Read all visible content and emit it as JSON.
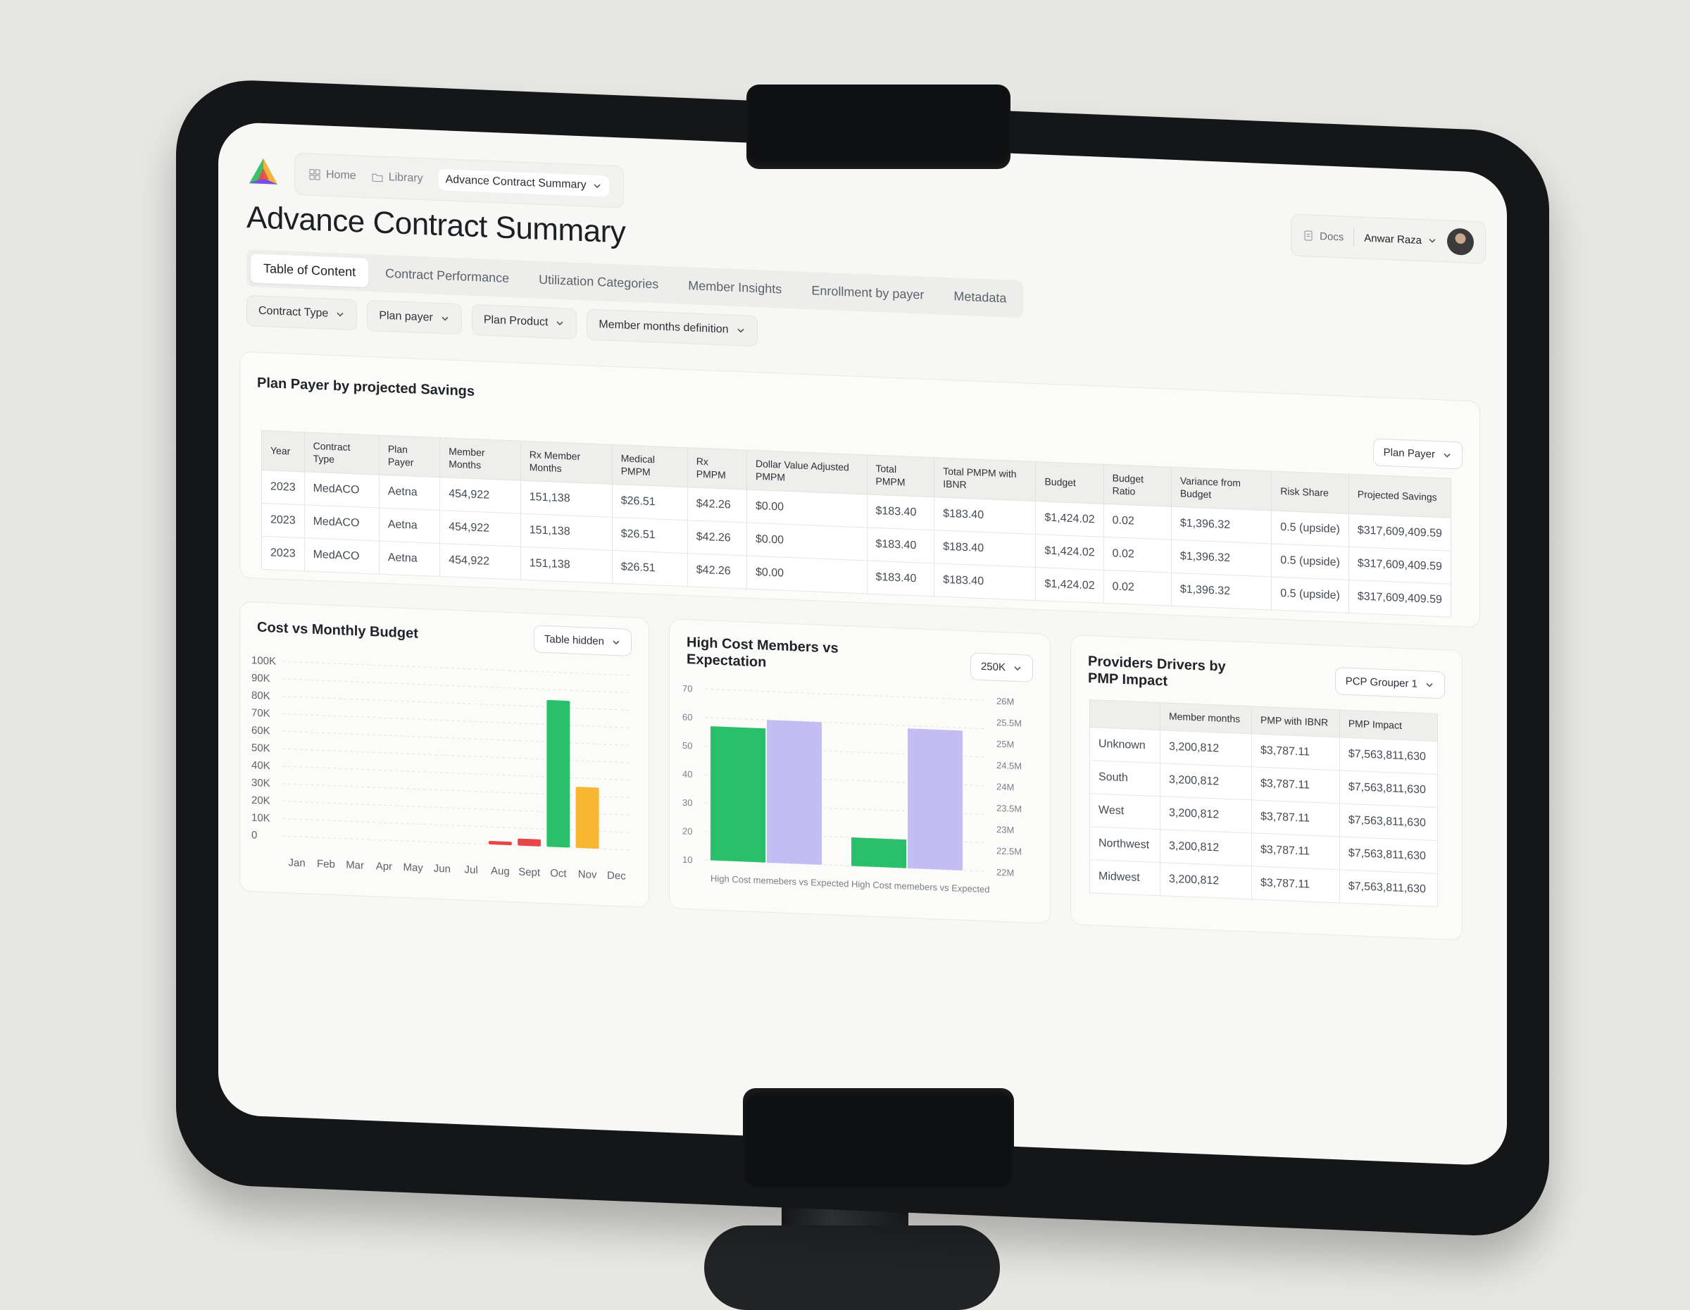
{
  "app": {
    "breadcrumbs": [
      "Home",
      "Library",
      "Advance Contract Summary"
    ],
    "page_title": "Advance Contract Summary",
    "docs_label": "Docs",
    "user_name": "Anwar Raza"
  },
  "tabs": [
    "Table of Content",
    "Contract Performance",
    "Utilization Categories",
    "Member Insights",
    "Enrollment by payer",
    "Metadata"
  ],
  "active_tab": "Table of Content",
  "filters": [
    "Contract Type",
    "Plan payer",
    "Plan Product",
    "Member months definition"
  ],
  "plan_payer_card": {
    "title": "Plan Payer by projected Savings",
    "dropdown": "Plan Payer",
    "columns": [
      "Year",
      "Contract Type",
      "Plan Payer",
      "Member Months",
      "Rx Member Months",
      "Medical PMPM",
      "Rx PMPM",
      "Dollar Value Adjusted PMPM",
      "Total PMPM",
      "Total PMPM with IBNR",
      "Budget",
      "Budget Ratio",
      "Variance from Budget",
      "Risk Share",
      "Projected Savings"
    ],
    "rows": [
      [
        "2023",
        "MedACO",
        "Aetna",
        "454,922",
        "151,138",
        "$26.51",
        "$42.26",
        "$0.00",
        "$183.40",
        "$183.40",
        "$1,424.02",
        "0.02",
        "$1,396.32",
        "0.5 (upside)",
        "$317,609,409.59"
      ],
      [
        "2023",
        "MedACO",
        "Aetna",
        "454,922",
        "151,138",
        "$26.51",
        "$42.26",
        "$0.00",
        "$183.40",
        "$183.40",
        "$1,424.02",
        "0.02",
        "$1,396.32",
        "0.5 (upside)",
        "$317,609,409.59"
      ],
      [
        "2023",
        "MedACO",
        "Aetna",
        "454,922",
        "151,138",
        "$26.51",
        "$42.26",
        "$0.00",
        "$183.40",
        "$183.40",
        "$1,424.02",
        "0.02",
        "$1,396.32",
        "0.5 (upside)",
        "$317,609,409.59"
      ]
    ]
  },
  "cost_card": {
    "title": "Cost vs Monthly Budget",
    "dropdown": "Table hidden"
  },
  "high_cost_card": {
    "title": "High Cost Members vs Expectation",
    "dropdown": "250K"
  },
  "providers_card": {
    "title": "Providers Drivers by PMP Impact",
    "dropdown": "PCP Grouper 1",
    "columns": [
      "",
      "Member months",
      "PMP with IBNR",
      "PMP Impact"
    ],
    "rows": [
      [
        "Unknown",
        "3,200,812",
        "$3,787.11",
        "$7,563,811,630"
      ],
      [
        "South",
        "3,200,812",
        "$3,787.11",
        "$7,563,811,630"
      ],
      [
        "West",
        "3,200,812",
        "$3,787.11",
        "$7,563,811,630"
      ],
      [
        "Northwest",
        "3,200,812",
        "$3,787.11",
        "$7,563,811,630"
      ],
      [
        "Midwest",
        "3,200,812",
        "$3,787.11",
        "$7,563,811,630"
      ]
    ]
  },
  "colors": {
    "green": "#2abf6b",
    "lavender": "#c4bdf5",
    "orange": "#f7b733",
    "red": "#e8474a"
  },
  "chart_data": [
    {
      "type": "bar",
      "title": "Cost vs Monthly Budget",
      "categories": [
        "Jan",
        "Feb",
        "Mar",
        "Apr",
        "May",
        "Jun",
        "Jul",
        "Aug",
        "Sept",
        "Oct",
        "Nov",
        "Dec"
      ],
      "series": [
        {
          "values": [
            0,
            0,
            0,
            0,
            0,
            0,
            0,
            2,
            4,
            84,
            0,
            0
          ],
          "colors": [
            "",
            "",
            "",
            "",
            "",
            "",
            "",
            "#e8474a",
            "#e8474a",
            "#2abf6b",
            "",
            ""
          ]
        },
        {
          "values": [
            0,
            0,
            0,
            0,
            0,
            0,
            0,
            0,
            0,
            0,
            35,
            0
          ],
          "colors": [
            "",
            "",
            "",
            "",
            "",
            "",
            "",
            "",
            "",
            "",
            "#f7b733",
            ""
          ]
        }
      ],
      "y_ticks": [
        "100K",
        "90K",
        "80K",
        "70K",
        "60K",
        "50K",
        "40K",
        "30K",
        "20K",
        "10K",
        "0"
      ],
      "ylim": [
        0,
        100
      ],
      "grid": true
    },
    {
      "type": "bar",
      "title": "High Cost Members vs Expectation",
      "categories": [
        "High Cost memebers vs Expected",
        "High Cost memebers vs Expected"
      ],
      "series": [
        {
          "values": [
            57,
            20
          ],
          "color": "#2abf6b"
        },
        {
          "values": [
            60,
            59
          ],
          "color": "#c4bdf5"
        }
      ],
      "y_ticks_left": [
        "70",
        "60",
        "50",
        "40",
        "30",
        "20",
        "10"
      ],
      "y_ticks_right": [
        "26M",
        "25.5M",
        "25M",
        "24.5M",
        "24M",
        "23.5M",
        "23M",
        "22.5M",
        "22M"
      ],
      "ylim": [
        10,
        70
      ],
      "grid": true
    }
  ]
}
